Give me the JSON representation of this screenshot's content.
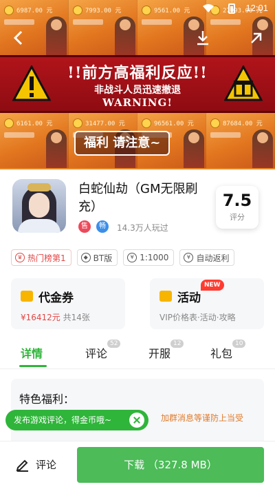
{
  "status_bar": {
    "time": "12:01"
  },
  "banner": {
    "tile_values_top": [
      "6987.00 元",
      "7993.00 元",
      "9561.00 元",
      "27993.00 元"
    ],
    "tile_values_bottom": [
      "6161.00 元",
      "31477.00 元",
      "96561.00 元",
      "87684.00 元"
    ],
    "warning_title": "!!前方高福利反应!!",
    "warning_sub": "非战斗人员迅速撤退",
    "warning_en": "WARNING!",
    "notice": "福利 请注意~"
  },
  "game": {
    "name": "白蛇仙劫（GM无限刷充）",
    "badge1": "售",
    "badge2": "畅",
    "players": "14.3万人玩过",
    "score": "7.5",
    "score_label": "评分"
  },
  "tags": [
    {
      "label": "热门榜第1"
    },
    {
      "label": "BT版"
    },
    {
      "label": "1:1000"
    },
    {
      "label": "自动返利"
    }
  ],
  "voucher": {
    "title": "代金券",
    "amount": "¥16412元",
    "count": "共14张"
  },
  "activity": {
    "title": "活动",
    "badge": "NEW",
    "subtitle": "VIP价格表·活动·攻略"
  },
  "tabs": [
    {
      "label": "详情",
      "count": ""
    },
    {
      "label": "评论",
      "count": "52"
    },
    {
      "label": "开服",
      "count": "12"
    },
    {
      "label": "礼包",
      "count": "10"
    }
  ],
  "welfare": {
    "title": "特色福利：",
    "text": "加群消息等谨防上当受"
  },
  "toast": {
    "text": "发布游戏评论，得金币哦~"
  },
  "bottom_bar": {
    "comment_label": "评论",
    "download_label": "下载 （327.8 MB）"
  },
  "colors": {
    "accent_green": "#2fb53a",
    "download_green": "#4cbb58",
    "warning_red": "#b0141a"
  }
}
